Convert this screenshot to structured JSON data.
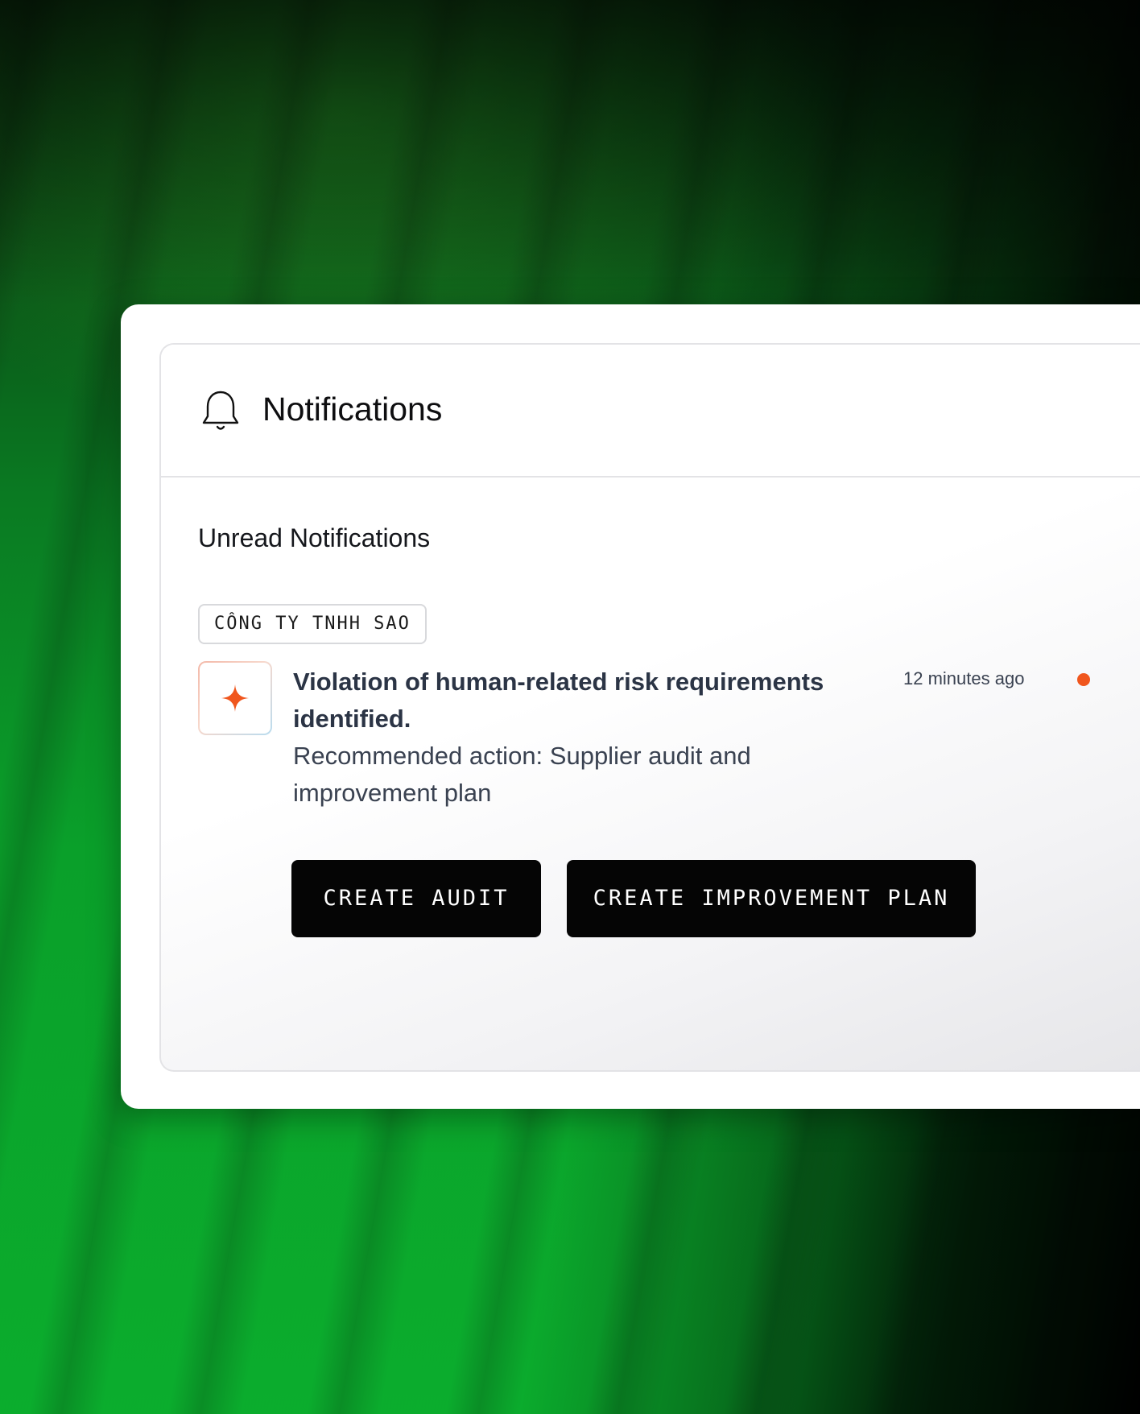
{
  "notifications": {
    "title": "Notifications",
    "header_icon": "bell-icon",
    "section_title": "Unread Notifications",
    "items": [
      {
        "company": "CÔNG TY TNHH SAO",
        "icon": "sparkle-icon",
        "title": "Violation of human-related risk requirements identified.",
        "description": "Recommended action: Supplier audit and improvement plan",
        "time": "12 minutes ago",
        "unread": true,
        "actions": [
          {
            "label": "CREATE AUDIT"
          },
          {
            "label": "CREATE IMPROVEMENT PLAN"
          }
        ]
      }
    ]
  },
  "colors": {
    "background": "#0aa02a",
    "accent": "#f0561d",
    "button": "#050505",
    "card": "#ffffff"
  }
}
